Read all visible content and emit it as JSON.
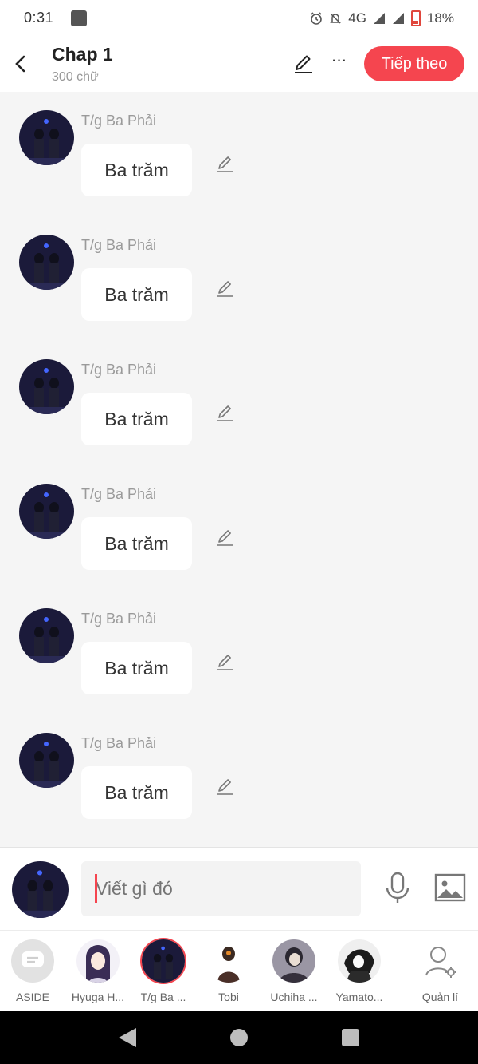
{
  "status_bar": {
    "time": "0:31",
    "network": "4G",
    "battery": "18%"
  },
  "header": {
    "title": "Chap 1",
    "subtitle": "300 chữ",
    "next_label": "Tiếp theo"
  },
  "messages": [
    {
      "author": "T/g Ba Phải",
      "text": "Ba trăm"
    },
    {
      "author": "T/g Ba Phải",
      "text": "Ba trăm"
    },
    {
      "author": "T/g Ba Phải",
      "text": "Ba trăm"
    },
    {
      "author": "T/g Ba Phải",
      "text": "Ba trăm"
    },
    {
      "author": "T/g Ba Phải",
      "text": "Ba trăm"
    },
    {
      "author": "T/g Ba Phải",
      "text": "Ba trăm"
    }
  ],
  "composer": {
    "placeholder": "Viết gì đó"
  },
  "characters": [
    {
      "name": "ASIDE",
      "icon": "message-bubble-icon"
    },
    {
      "name": "Hyuga H..."
    },
    {
      "name": "T/g Ba ..."
    },
    {
      "name": "Tobi"
    },
    {
      "name": "Uchiha ..."
    },
    {
      "name": "Yamato..."
    }
  ],
  "manage_label": "Quản lí",
  "colors": {
    "accent": "#f5454f",
    "background": "#f5f5f5"
  }
}
